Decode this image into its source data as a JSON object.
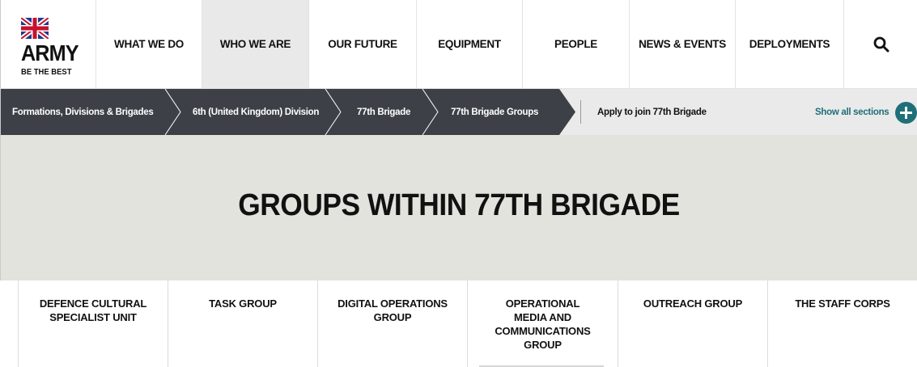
{
  "brand": {
    "logo_text": "ARMY",
    "tagline": "BE THE BEST",
    "flag_icon": "union-jack-icon"
  },
  "nav": {
    "items": [
      {
        "label": "WHAT WE DO"
      },
      {
        "label": "WHO WE ARE",
        "active": true
      },
      {
        "label": "OUR FUTURE"
      },
      {
        "label": "EQUIPMENT"
      },
      {
        "label": "PEOPLE"
      },
      {
        "label": "NEWS & EVENTS"
      },
      {
        "label": "DEPLOYMENTS"
      }
    ],
    "search_icon": "search-icon"
  },
  "breadcrumb": {
    "items": [
      {
        "label": "Formations, Divisions & Brigades"
      },
      {
        "label": "6th (United Kingdom) Division"
      },
      {
        "label": "77th Brigade"
      },
      {
        "label": "77th Brigade Groups"
      }
    ],
    "apply_link": "Apply to join 77th Brigade",
    "show_all": "Show all sections",
    "show_all_icon": "plus-circle-icon"
  },
  "hero": {
    "title": "GROUPS WITHIN 77TH BRIGADE"
  },
  "groups": [
    {
      "label": "DEFENCE CULTURAL SPECIALIST UNIT"
    },
    {
      "label": "TASK GROUP"
    },
    {
      "label": "DIGITAL OPERATIONS GROUP"
    },
    {
      "label": "OPERATIONAL MEDIA AND COMMUNICATIONS GROUP"
    },
    {
      "label": "OUTREACH GROUP"
    },
    {
      "label": "THE STAFF CORPS"
    }
  ],
  "colors": {
    "crumb_dark": "#3d4147",
    "crumb_separator": "#ffffff",
    "show_all_teal": "#1f6f78",
    "hero_bg": "#e3e3dd",
    "active_nav_bg": "#e9e9e9"
  }
}
